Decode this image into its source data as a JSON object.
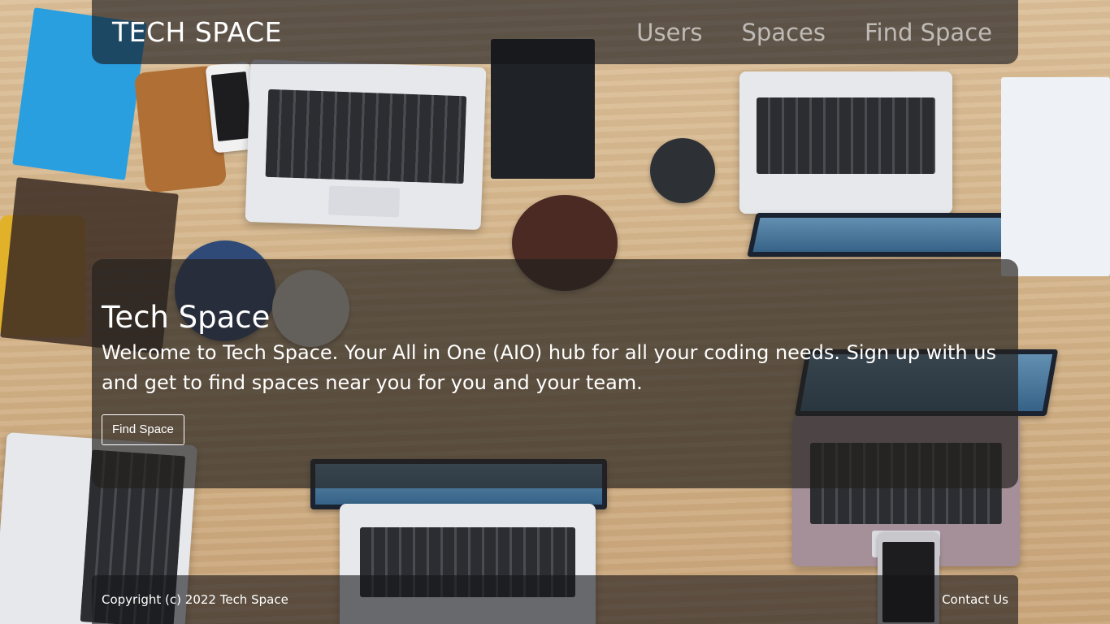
{
  "navbar": {
    "brand": "TECH SPACE",
    "links": [
      {
        "label": "Users"
      },
      {
        "label": "Spaces"
      },
      {
        "label": "Find Space"
      }
    ]
  },
  "hero": {
    "title": "Tech Space",
    "text": "Welcome to Tech Space. Your All in One (AIO) hub for all your coding needs. Sign up with us and get to find spaces near you for you and your team.",
    "button_label": "Find Space"
  },
  "footer": {
    "copyright": "Copyright (c) 2022 Tech Space",
    "contact_label": "Contact Us"
  },
  "colors": {
    "panel_overlay": "#141418",
    "text": "#ffffff",
    "nav_link_muted": "#bdbdbd"
  }
}
